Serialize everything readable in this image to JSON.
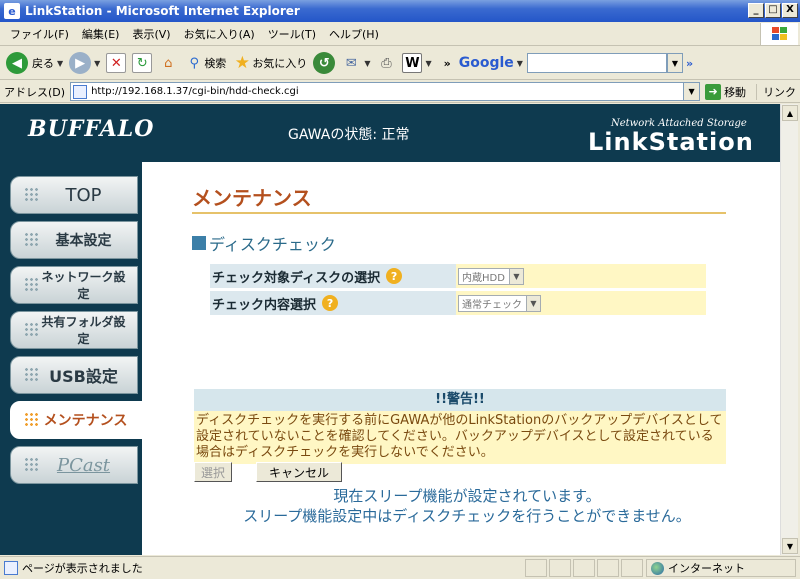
{
  "window": {
    "title": "LinkStation - Microsoft Internet Explorer",
    "controls": [
      "_",
      "□",
      "X"
    ]
  },
  "menu": {
    "file": "ファイル(F)",
    "edit": "編集(E)",
    "view": "表示(V)",
    "favorites": "お気に入り(A)",
    "tools": "ツール(T)",
    "help": "ヘルプ(H)"
  },
  "toolbar": {
    "back": "戻る",
    "search": "検索",
    "favorites": "お気に入り",
    "google": "Google",
    "overflow": "»"
  },
  "address": {
    "label": "アドレス(D)",
    "url": "http://192.168.1.37/cgi-bin/hdd-check.cgi",
    "go": "移動",
    "links": "リンク"
  },
  "banner": {
    "brand": "BUFFALO",
    "status": "GAWAの状態: 正常",
    "tagline": "Network Attached Storage",
    "product": "LinkStation"
  },
  "nav": {
    "top": "TOP",
    "basic": "基本設定",
    "network": "ネットワーク設定",
    "shared": "共有フォルダ設定",
    "usb": "USB設定",
    "maintenance": "メンテナンス",
    "pcast": "PCast"
  },
  "main": {
    "title": "メンテナンス",
    "section": "ディスクチェック",
    "field1": {
      "label": "チェック対象ディスクの選択",
      "value": "内蔵HDD"
    },
    "field2": {
      "label": "チェック内容選択",
      "value": "通常チェック"
    },
    "help_icon": "?",
    "warning": {
      "header": "!!警告!!",
      "body": "ディスクチェックを実行する前にGAWAが他のLinkStationのバックアップデバイスとして設定されていないことを確認してください。バックアップデバイスとして設定されている場合はディスクチェックを実行しないでください。"
    },
    "select_button": "選択",
    "cancel_button": "キャンセル",
    "note_line1": "現在スリープ機能が設定されています。",
    "note_line2": "スリープ機能設定中はディスクチェックを行うことができません。"
  },
  "statusbar": {
    "text": "ページが表示されました",
    "zone": "インターネット"
  },
  "colors": {
    "banner_bg": "#0e3a4f",
    "title_accent": "#b4501e",
    "field_label_bg": "#dce8ee",
    "field_value_bg": "#fff7c4",
    "note_text": "#2a6a9a"
  }
}
